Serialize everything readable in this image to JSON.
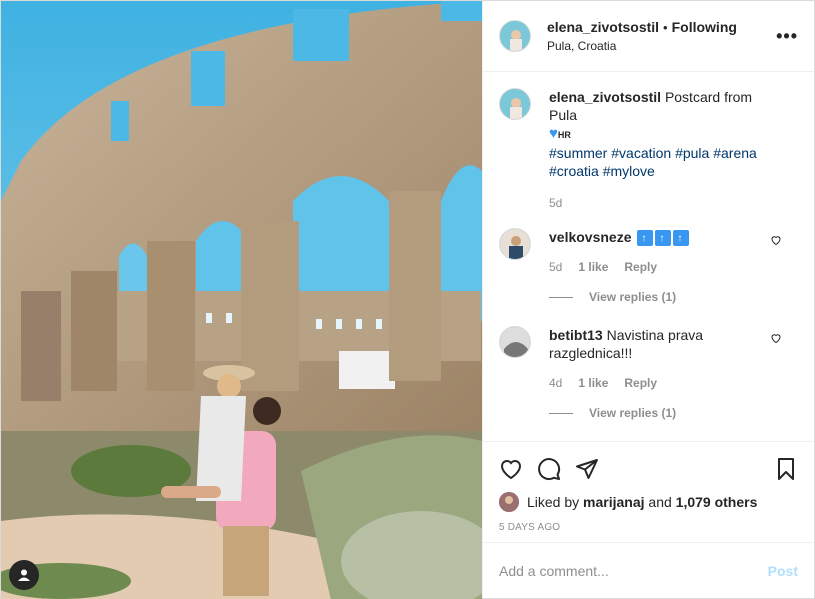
{
  "post": {
    "username": "elena_zivotsostil",
    "follow_separator": "•",
    "follow_state": "Following",
    "location": "Pula, Croatia",
    "more_icon": "more-horizontal-icon"
  },
  "caption": {
    "username": "elena_zivotsostil",
    "text": "Postcard from Pula",
    "flag_label": "HR",
    "hashtags": [
      "#summer",
      "#vacation",
      "#pula",
      "#arena",
      "#croatia",
      "#mylove"
    ],
    "age": "5d"
  },
  "comments": [
    {
      "username": "velkovsneze",
      "text": "",
      "age": "5d",
      "likes": "1 like",
      "reply_label": "Reply",
      "view_replies": "View replies (1)"
    },
    {
      "username": "betibt13",
      "text": "Navistina prava razglednica!!!",
      "age": "4d",
      "likes": "1 like",
      "reply_label": "Reply",
      "view_replies": "View replies (1)"
    }
  ],
  "actions": {
    "liked_prefix": "Liked by",
    "liked_user": "marijanaj",
    "liked_and": "and",
    "liked_count": "1,079 others",
    "time_ago": "5 DAYS AGO"
  },
  "composer": {
    "placeholder": "Add a comment...",
    "post_label": "Post"
  },
  "colors": {
    "hashtag": "#00376b",
    "muted": "#8e8e8e",
    "post_disabled": "#b2dffc",
    "sky": "#5fbfe6"
  }
}
